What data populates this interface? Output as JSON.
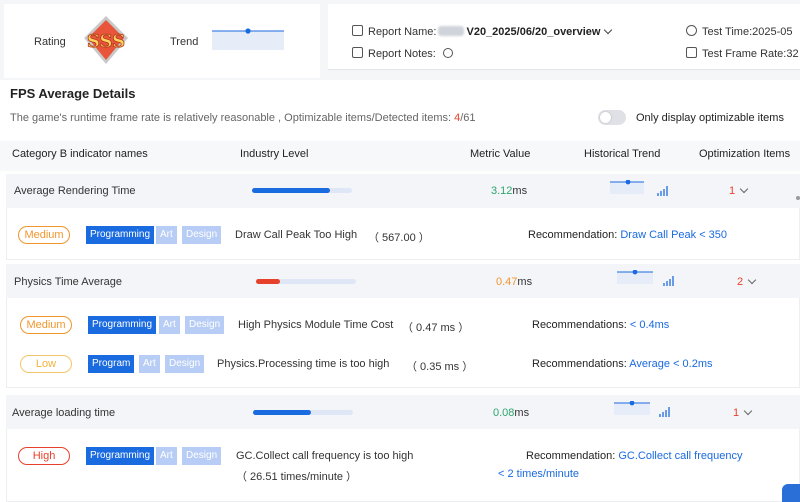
{
  "header": {
    "rating_label": "Rating",
    "trend_label": "Trend",
    "report_name_label": "Report Name:",
    "report_name_value": "V20_2025/06/20_overview",
    "report_notes_label": "Report Notes:",
    "test_time_label": "Test Time:",
    "test_time_value": "2025-05",
    "test_frame_rate_label": "Test Frame Rate:",
    "test_frame_rate_value": "32"
  },
  "section": {
    "title": "FPS Average Details",
    "summary_prefix": "The game's runtime frame rate is relatively reasonable , Optimizable items/Detected items: ",
    "optimizable": "4",
    "separator": "/",
    "detected": "61",
    "toggle_label": "Only display optimizable items"
  },
  "table": {
    "headers": [
      "Category B indicator names",
      "Industry Level",
      "Metric Value",
      "Historical Trend",
      "Optimization Items"
    ]
  },
  "rows": [
    {
      "name": "Average Rendering Time",
      "value": "3.12",
      "unit": "ms",
      "level": 0.78,
      "count": "1",
      "issues": [
        {
          "severity": "Medium",
          "chips": [
            "Programming",
            "Art",
            "Design"
          ],
          "text": "Draw Call Peak Too High",
          "metric": "（ 567.00 ）",
          "rec_label": "Recommendation:",
          "rec_value": "Draw Call Peak < 350"
        }
      ]
    },
    {
      "name": "Physics Time Average",
      "value": "0.47",
      "unit": "ms",
      "level": 0.24,
      "count": "2",
      "issues": [
        {
          "severity": "Medium",
          "chips": [
            "Programming",
            "Art",
            "Design"
          ],
          "text": "High Physics Module Time Cost",
          "metric": "（ 0.47 ms ）",
          "rec_label": "Recommendations:",
          "rec_value": "< 0.4ms"
        },
        {
          "severity": "Low",
          "chips": [
            "Program",
            "Art",
            "Design"
          ],
          "text": "Physics.Processing time is too high",
          "metric": "（ 0.35 ms ）",
          "rec_label": "Recommendations:",
          "rec_value": "Average < 0.2ms"
        }
      ]
    },
    {
      "name": "Average loading time",
      "value": "0.08",
      "unit": "ms",
      "level": 0.58,
      "count": "1",
      "issues": [
        {
          "severity": "High",
          "chips": [
            "Programming",
            "Art",
            "Design"
          ],
          "text": "GC.Collect call frequency is too high",
          "metric": "（ 26.51 times/minute ）",
          "rec_label": "Recommendation:",
          "rec_value": "GC.Collect call frequency",
          "rec_value_2": "< 2 times/minute"
        }
      ]
    }
  ],
  "colors": {
    "accent": "#1a6ae0",
    "good": "#2ea56d",
    "warn": "#f0962c",
    "bad": "#e8412b"
  }
}
